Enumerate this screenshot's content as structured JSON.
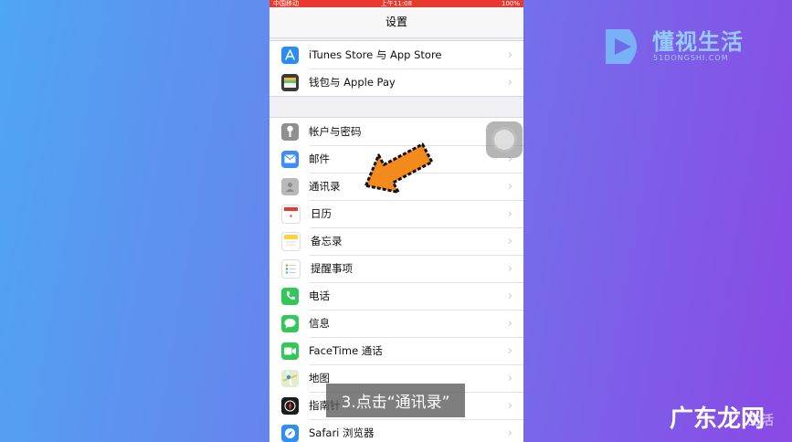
{
  "statusbar": {
    "carrier": "中国移动",
    "time": "上午11:08",
    "battery": "100%"
  },
  "navbar": {
    "title": "设置"
  },
  "groups": [
    {
      "items": [
        {
          "label": "iTunes Store 与 App Store",
          "icon": "app-store-icon",
          "color": "#2b8cf5"
        },
        {
          "label": "钱包与 Apple Pay",
          "icon": "wallet-icon",
          "color": "#3a3a3c"
        }
      ]
    },
    {
      "items": [
        {
          "label": "帐户与密码",
          "icon": "key-icon",
          "color": "#8e8e93"
        },
        {
          "label": "邮件",
          "icon": "mail-icon",
          "color": "#3c8ef5"
        },
        {
          "label": "通讯录",
          "icon": "contacts-icon",
          "color": "#b9b9b9"
        },
        {
          "label": "日历",
          "icon": "calendar-icon",
          "color": "#ffffff"
        },
        {
          "label": "备忘录",
          "icon": "notes-icon",
          "color": "#ffd23f"
        },
        {
          "label": "提醒事项",
          "icon": "reminders-icon",
          "color": "#ffffff"
        },
        {
          "label": "电话",
          "icon": "phone-icon",
          "color": "#33c759"
        },
        {
          "label": "信息",
          "icon": "messages-icon",
          "color": "#33c759"
        },
        {
          "label": "FaceTime 通话",
          "icon": "facetime-icon",
          "color": "#33c759"
        },
        {
          "label": "地图",
          "icon": "maps-icon",
          "color": "#8dc86a"
        },
        {
          "label": "指南针",
          "icon": "compass-icon",
          "color": "#1c1c1e"
        },
        {
          "label": "Safari 浏览器",
          "icon": "safari-icon",
          "color": "#2f8ff0"
        }
      ]
    }
  ],
  "caption": "3.点击“通讯录”",
  "watermark": {
    "name": "懂视生活",
    "sub": "51DONGSHI.COM"
  },
  "corner": {
    "text": "广东龙网",
    "sub": "生活"
  }
}
